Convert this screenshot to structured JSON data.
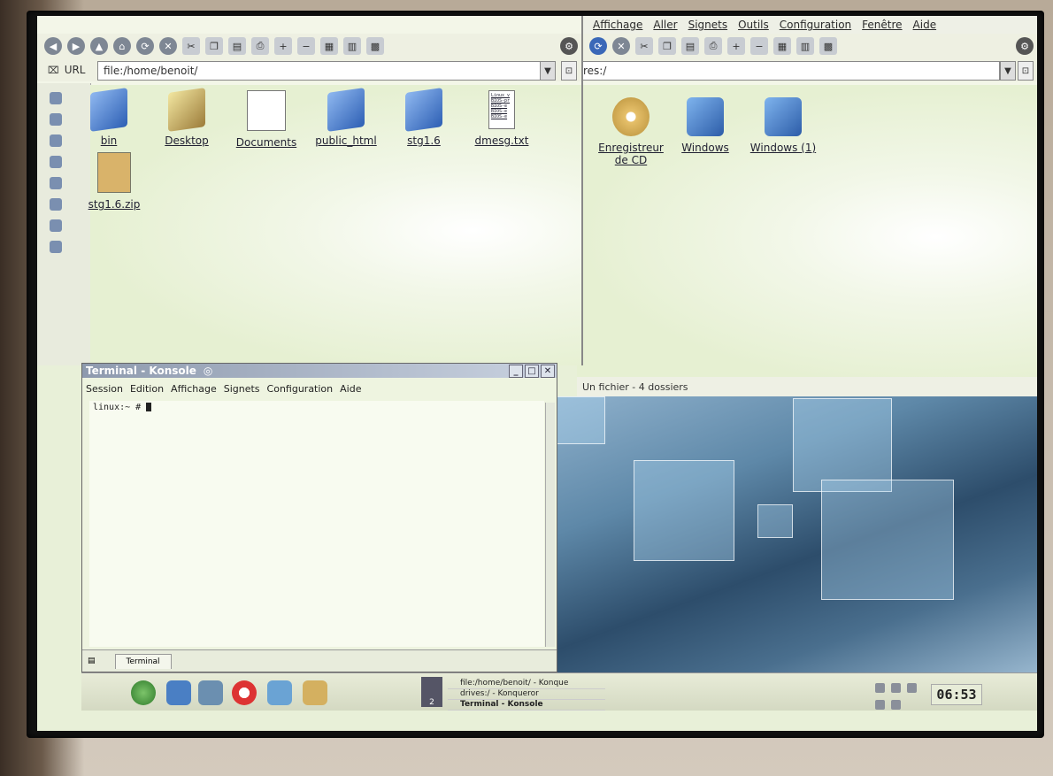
{
  "right_window": {
    "menu": [
      "Affichage",
      "Aller",
      "Signets",
      "Outils",
      "Configuration",
      "Fenêtre",
      "Aide"
    ],
    "url_value": "res:/",
    "files": [
      {
        "label": "Enregistreur\nde CD",
        "icon": "cd-burner-icon"
      },
      {
        "label": "Windows",
        "icon": "windows-drive-icon"
      },
      {
        "label": "Windows (1)",
        "icon": "windows-drive-icon"
      }
    ],
    "status": "Un fichier - 4 dossiers"
  },
  "left_window": {
    "url_label": "URL",
    "url_value": "file:/home/benoit/",
    "files": [
      {
        "label": "bin",
        "icon": "folder-icon"
      },
      {
        "label": "Desktop",
        "icon": "desktop-folder-icon"
      },
      {
        "label": "Documents",
        "icon": "document-icon"
      },
      {
        "label": "public_html",
        "icon": "web-folder-icon"
      },
      {
        "label": "stg1.6",
        "icon": "folder-icon"
      },
      {
        "label": "dmesg.txt",
        "icon": "text-file-icon"
      },
      {
        "label": "stg1.6.zip",
        "icon": "zip-archive-icon"
      }
    ],
    "dmesg_preview": "Linux v\nBIOS-pr\nBIOS-e\nBIOS-e\nBIOS-e"
  },
  "konsole": {
    "title": "Terminal - Konsole",
    "menu": [
      "Session",
      "Edition",
      "Affichage",
      "Signets",
      "Configuration",
      "Aide"
    ],
    "prompt": "linux:~ #",
    "tab_label": "Terminal"
  },
  "taskbar": {
    "pager_number": "2",
    "tasks": [
      "file:/home/benoit/ - Konque",
      "drives:/ - Konqueror",
      "Terminal - Konsole"
    ],
    "clock": "06:53"
  }
}
